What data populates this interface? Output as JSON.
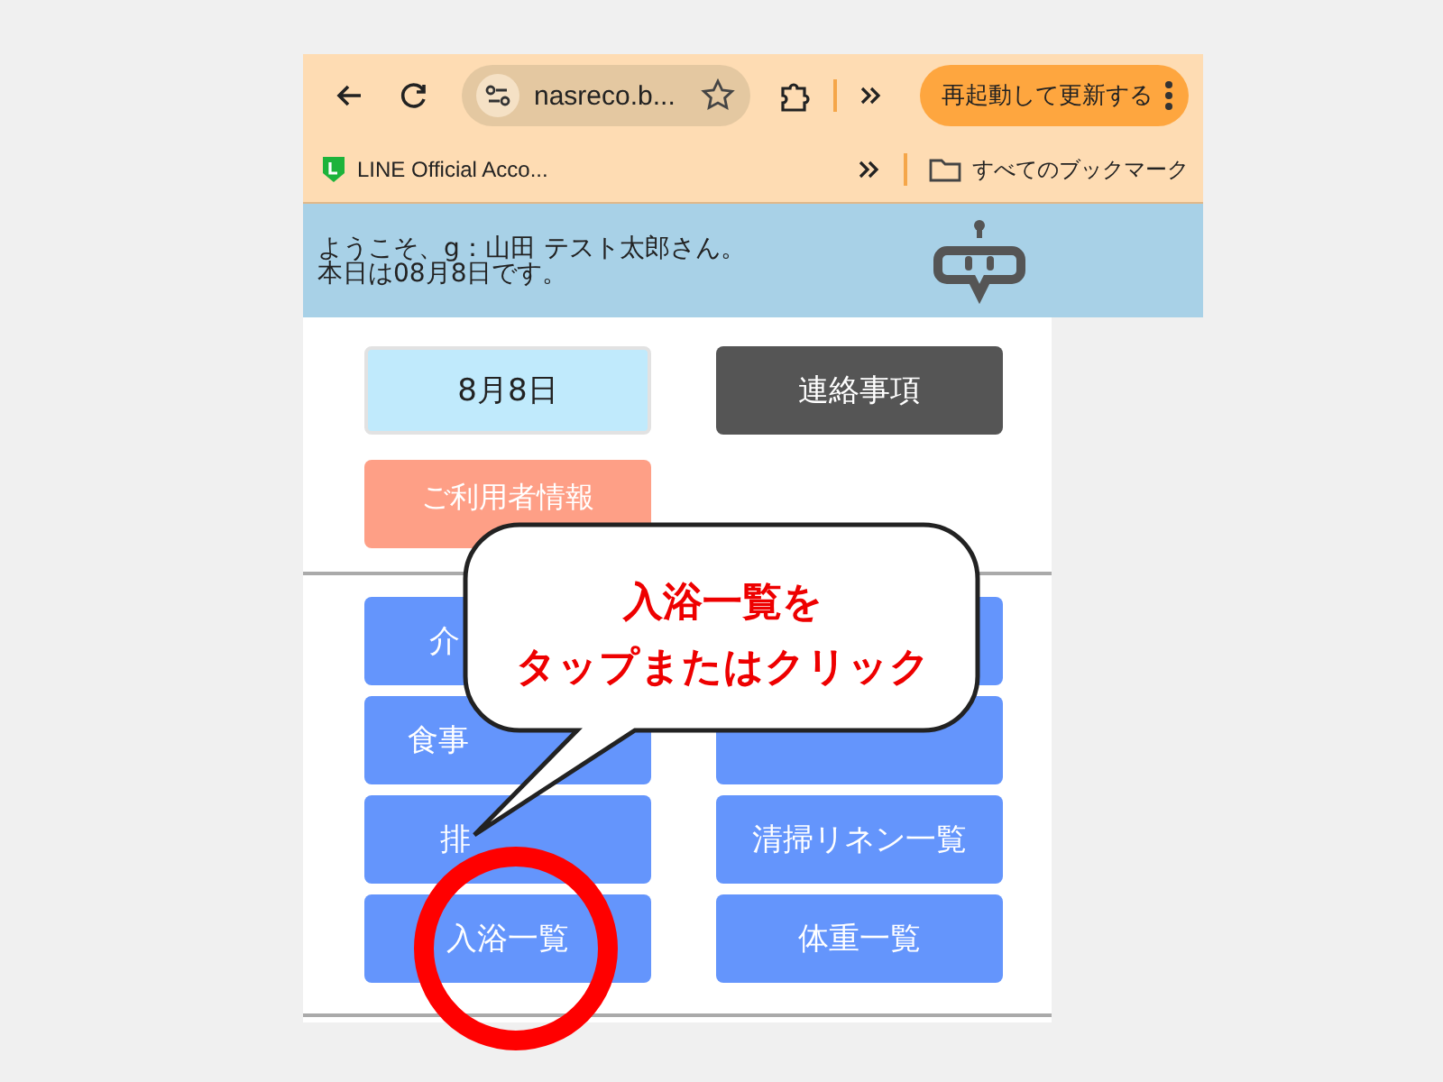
{
  "browser": {
    "url": "nasreco.b...",
    "update_button": "再起動して更新する",
    "bookmarks": [
      {
        "label": "LINE Official Acco..."
      }
    ],
    "all_bookmarks": "すべてのブックマーク"
  },
  "header": {
    "welcome": "ようこそ、g：山田 テスト太郎さん。",
    "today": "本日は08月8日です。"
  },
  "top_buttons": [
    {
      "label": "8月8日",
      "kind": "date"
    },
    {
      "label": "連絡事項",
      "kind": "notice"
    },
    {
      "label": "ご利用者情報",
      "kind": "user"
    }
  ],
  "list_buttons": [
    {
      "kind": "label",
      "label": "介"
    },
    {
      "kind": "covered"
    },
    {
      "kind": "label",
      "label": "食事"
    },
    {
      "kind": "covered"
    },
    {
      "kind": "label",
      "label": "排"
    },
    {
      "kind": "label",
      "label": "清掃リネン一覧"
    },
    {
      "kind": "label",
      "label": "入浴一覧"
    },
    {
      "kind": "label",
      "label": "体重一覧"
    }
  ],
  "callout": {
    "lines": [
      "入浴一覧を",
      "タップまたはクリック"
    ]
  }
}
